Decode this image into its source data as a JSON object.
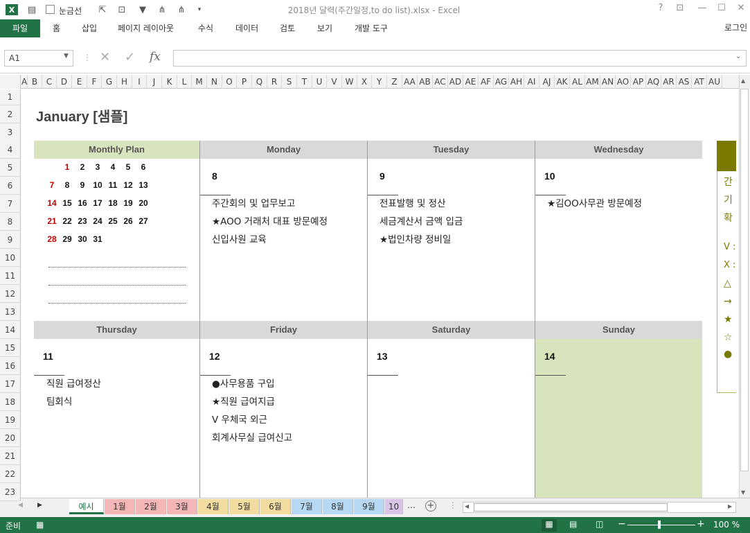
{
  "window": {
    "title": "2018년 달력(주간일정,to do list).xlsx - Excel",
    "help": "?",
    "gridlines_label": "눈금선",
    "login": "로그인"
  },
  "ribbon_tabs": [
    "파일",
    "홈",
    "삽입",
    "페이지 레이아웃",
    "수식",
    "데이터",
    "검토",
    "보기",
    "개발 도구"
  ],
  "namebox": "A1",
  "fx": "fx",
  "columns": [
    "A",
    "B",
    "C",
    "D",
    "E",
    "F",
    "G",
    "H",
    "I",
    "J",
    "K",
    "L",
    "M",
    "N",
    "O",
    "P",
    "Q",
    "R",
    "S",
    "T",
    "U",
    "V",
    "W",
    "X",
    "Y",
    "Z",
    "AA",
    "AB",
    "AC",
    "AD",
    "AE",
    "AF",
    "AG",
    "AH",
    "AI",
    "AJ",
    "AK",
    "AL",
    "AM",
    "AN",
    "AO",
    "AP",
    "AQ",
    "AR",
    "AS",
    "AT",
    "AU"
  ],
  "rows": [
    "1",
    "2",
    "3",
    "4",
    "5",
    "6",
    "7",
    "8",
    "9",
    "10",
    "11",
    "12",
    "13",
    "14",
    "15",
    "16",
    "17",
    "18",
    "19",
    "20",
    "21",
    "22",
    "23"
  ],
  "sheet_title": "January [샘플]",
  "monthly_plan": {
    "header": "Monthly Plan",
    "weeks": [
      [
        "",
        "",
        "1",
        "2",
        "3",
        "4",
        "5",
        "6"
      ],
      [
        "7",
        "8",
        "9",
        "10",
        "11",
        "12",
        "13"
      ],
      [
        "14",
        "15",
        "16",
        "17",
        "18",
        "19",
        "20"
      ],
      [
        "21",
        "22",
        "23",
        "24",
        "25",
        "26",
        "27"
      ],
      [
        "28",
        "29",
        "30",
        "31"
      ]
    ]
  },
  "days_top": [
    {
      "name": "Monday",
      "date": "8",
      "tasks": [
        "주간회의 및 업무보고",
        "★AOO 거래처 대표 방문예정",
        "신입사원 교육"
      ]
    },
    {
      "name": "Tuesday",
      "date": "9",
      "tasks": [
        "전표발행 및 정산",
        "세금계산서 금액 입금",
        "★법인차량 정비일"
      ]
    },
    {
      "name": "Wednesday",
      "date": "10",
      "tasks": [
        "★김OO사무관 방문예정"
      ]
    }
  ],
  "days_bottom": [
    {
      "name": "Thursday",
      "date": "11",
      "tasks": [
        "직원 급여정산",
        "팀회식"
      ]
    },
    {
      "name": "Friday",
      "date": "12",
      "tasks": [
        "●사무용품 구입",
        "★직원 급여지급",
        "V 우체국 외근",
        "회계사무실 급여신고"
      ]
    },
    {
      "name": "Saturday",
      "date": "13",
      "tasks": []
    },
    {
      "name": "Sunday",
      "date": "14",
      "tasks": []
    }
  ],
  "legend": [
    "간",
    "기",
    "확",
    "",
    "V :",
    "X :",
    "△",
    "→",
    "★",
    "☆",
    "●"
  ],
  "sheet_tabs": [
    "예시",
    "1월",
    "2월",
    "3월",
    "4월",
    "5월",
    "6월",
    "7월",
    "8월",
    "9월",
    "10"
  ],
  "status": {
    "ready": "준비",
    "zoom": "100 %"
  },
  "colors": {
    "accent": "#217346",
    "plan_header": "#d8e4bc",
    "day_header": "#d9d9d9",
    "sunday": "#d8e4bc",
    "legend_header": "#7a7a00"
  }
}
